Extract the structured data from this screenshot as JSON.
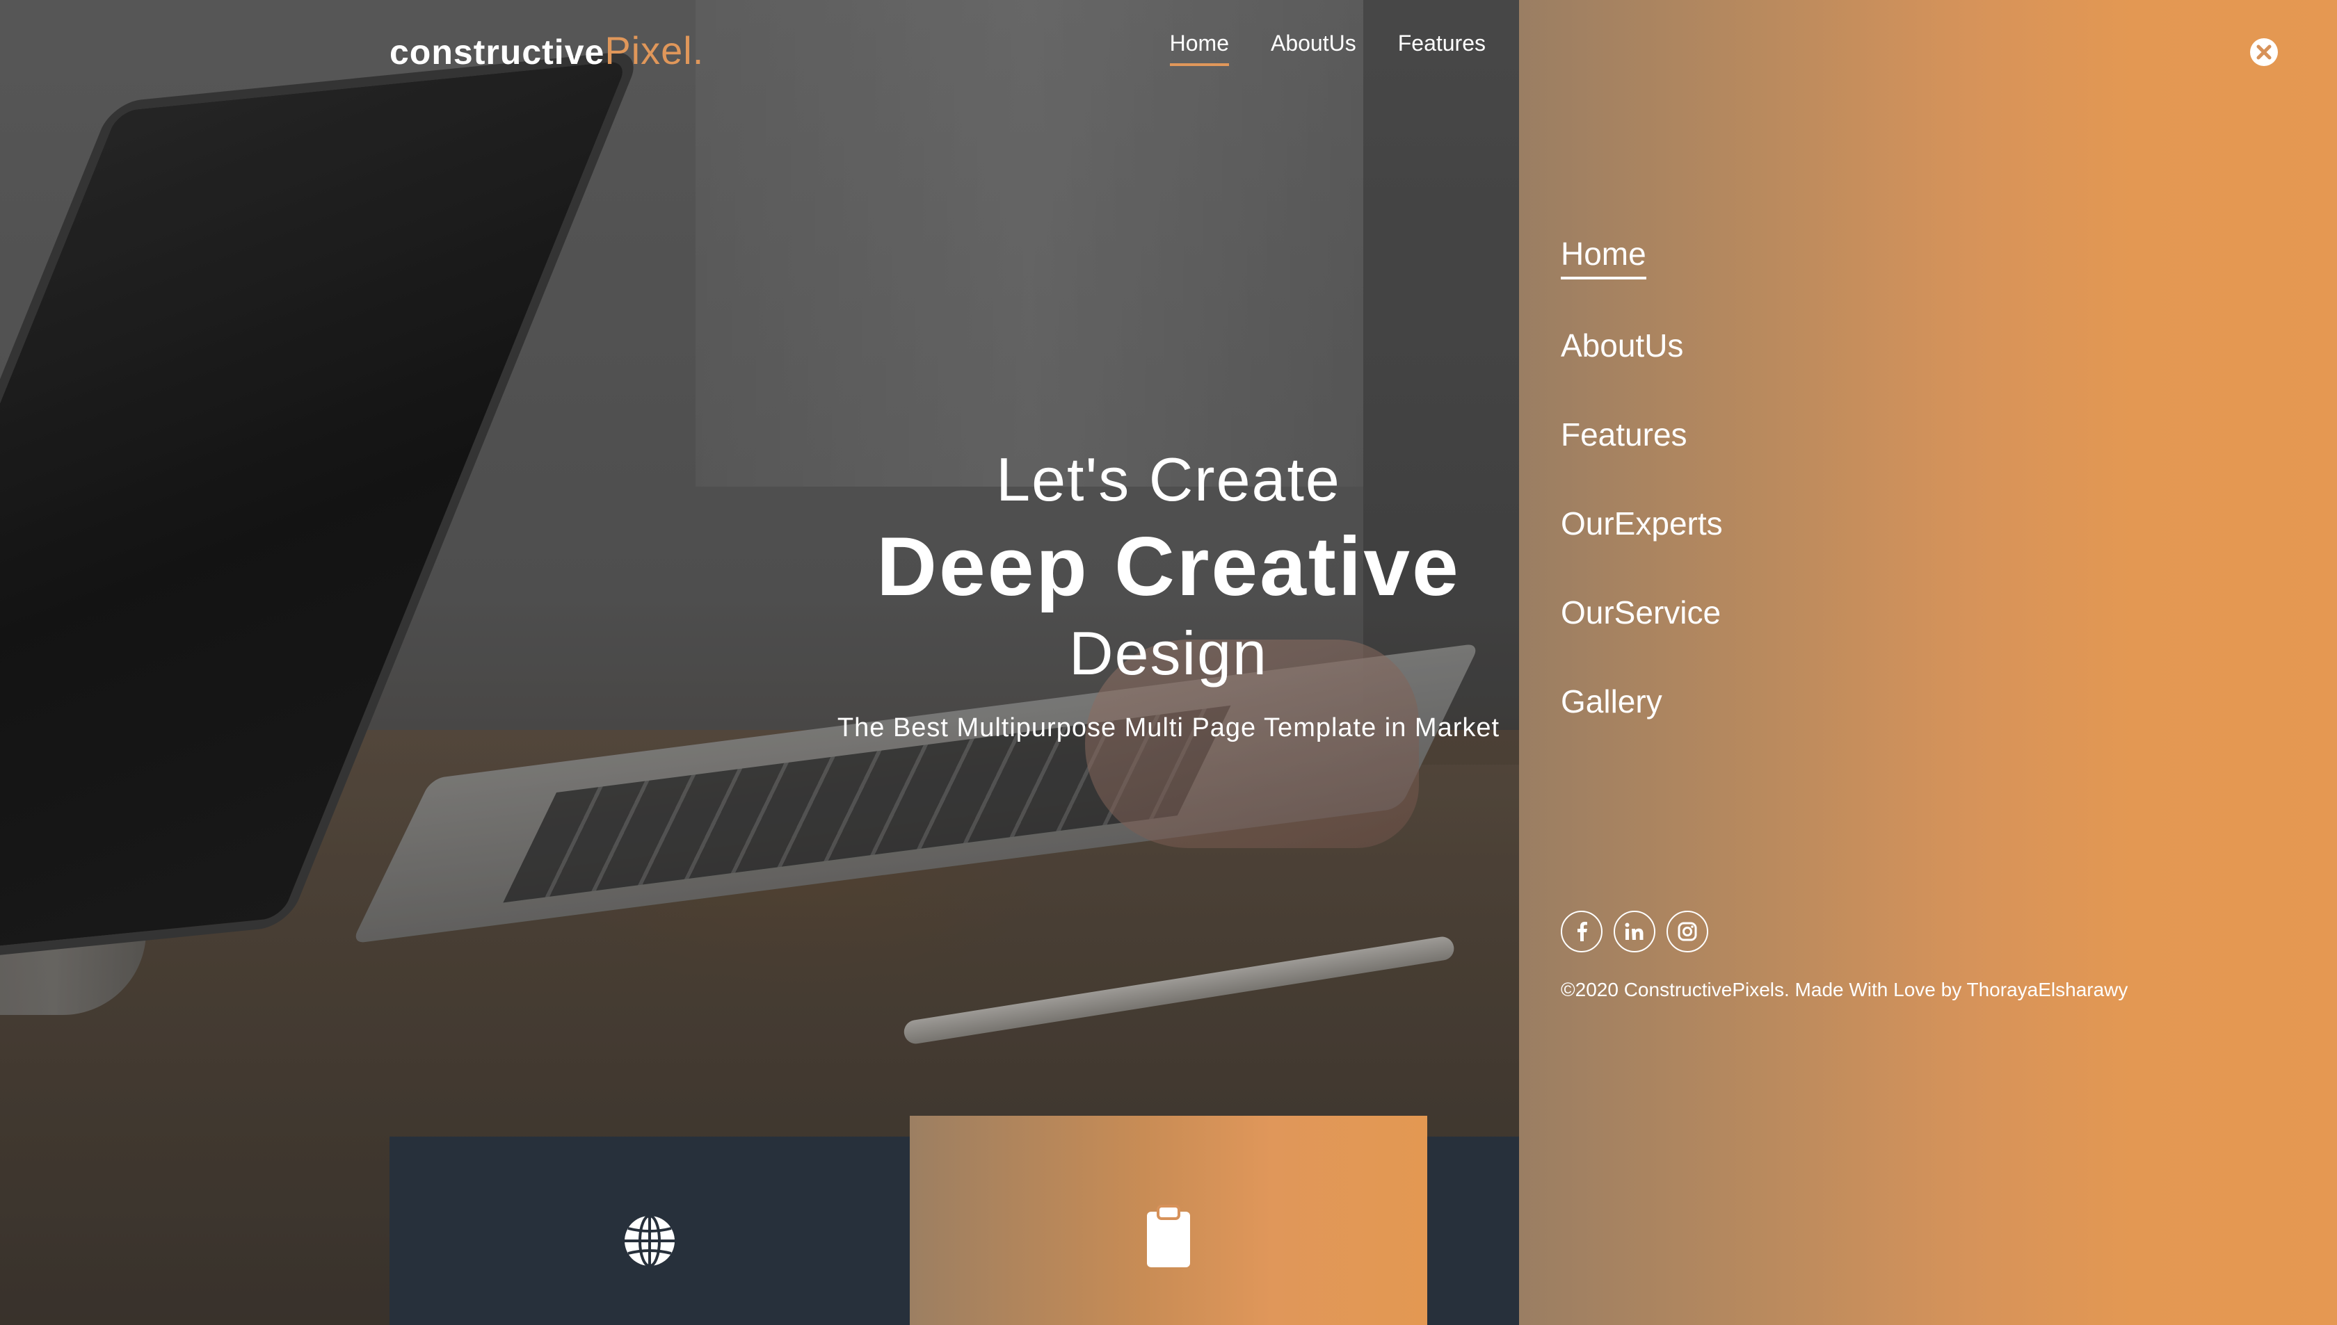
{
  "brand": {
    "name_part1": "constructive",
    "name_part2": "Pixel",
    "name_dot": ".",
    "accent_color": "#e0975a"
  },
  "top_nav": {
    "items": [
      "Home",
      "AboutUs",
      "Features"
    ],
    "active": "Home"
  },
  "hero": {
    "line1": "Let's Create",
    "line2": "Deep Creative",
    "line3": "Design",
    "subtitle": "The Best Multipurpose Multi Page Template in Market"
  },
  "features": [
    {
      "icon": "globe-icon",
      "background": "#27303b"
    },
    {
      "icon": "clipboard-icon",
      "background": "#e0975a"
    }
  ],
  "side_panel": {
    "close_icon": "close-icon",
    "menu": [
      "Home",
      "AboutUs",
      "Features",
      "OurExperts",
      "OurService",
      "Gallery"
    ],
    "active": "Home",
    "social": [
      "facebook-icon",
      "linkedin-icon",
      "instagram-icon"
    ],
    "copyright": "©2020 ConstructivePixels. Made With Love by ThorayaElsharawy"
  }
}
